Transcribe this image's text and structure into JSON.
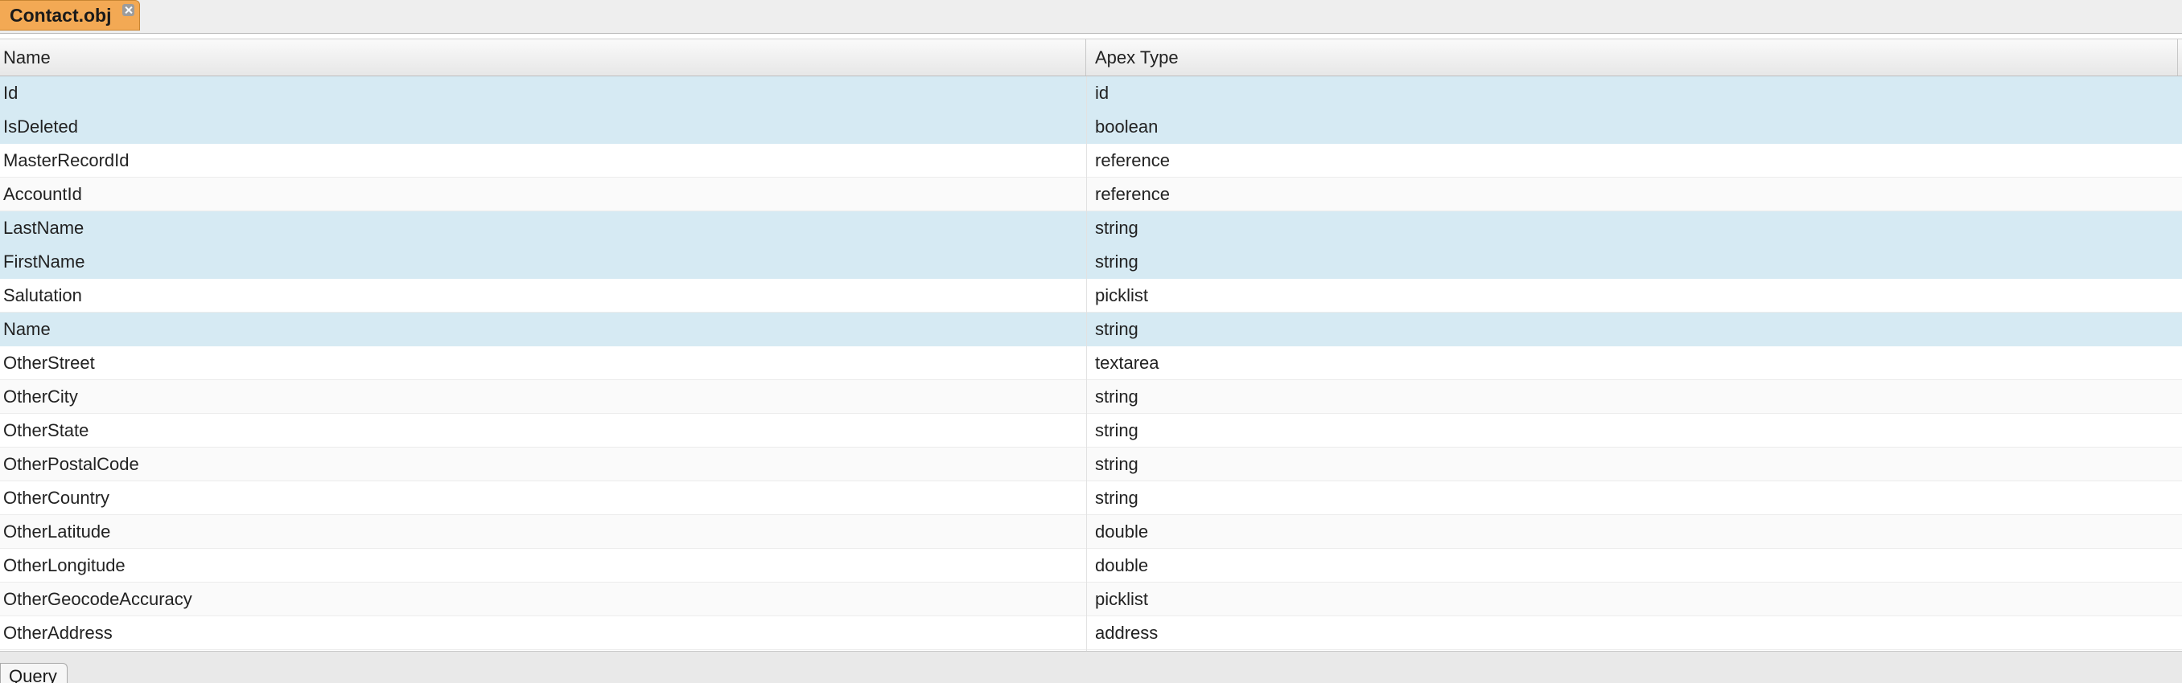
{
  "tab": {
    "label": "Contact.obj"
  },
  "grid": {
    "columns": [
      "Name",
      "Apex Type"
    ],
    "rows": [
      {
        "name": "Id",
        "type": "id",
        "selected": true
      },
      {
        "name": "IsDeleted",
        "type": "boolean",
        "selected": true
      },
      {
        "name": "MasterRecordId",
        "type": "reference",
        "selected": false
      },
      {
        "name": "AccountId",
        "type": "reference",
        "selected": false
      },
      {
        "name": "LastName",
        "type": "string",
        "selected": true
      },
      {
        "name": "FirstName",
        "type": "string",
        "selected": true
      },
      {
        "name": "Salutation",
        "type": "picklist",
        "selected": false
      },
      {
        "name": "Name",
        "type": "string",
        "selected": true
      },
      {
        "name": "OtherStreet",
        "type": "textarea",
        "selected": false
      },
      {
        "name": "OtherCity",
        "type": "string",
        "selected": false
      },
      {
        "name": "OtherState",
        "type": "string",
        "selected": false
      },
      {
        "name": "OtherPostalCode",
        "type": "string",
        "selected": false
      },
      {
        "name": "OtherCountry",
        "type": "string",
        "selected": false
      },
      {
        "name": "OtherLatitude",
        "type": "double",
        "selected": false
      },
      {
        "name": "OtherLongitude",
        "type": "double",
        "selected": false
      },
      {
        "name": "OtherGeocodeAccuracy",
        "type": "picklist",
        "selected": false
      },
      {
        "name": "OtherAddress",
        "type": "address",
        "selected": false
      }
    ]
  },
  "bottom": {
    "query_label": "Query"
  },
  "icons": {
    "tab_close": "close-icon"
  },
  "colors": {
    "active_tab": "#f3a954",
    "selected_row": "#d6eaf3"
  }
}
